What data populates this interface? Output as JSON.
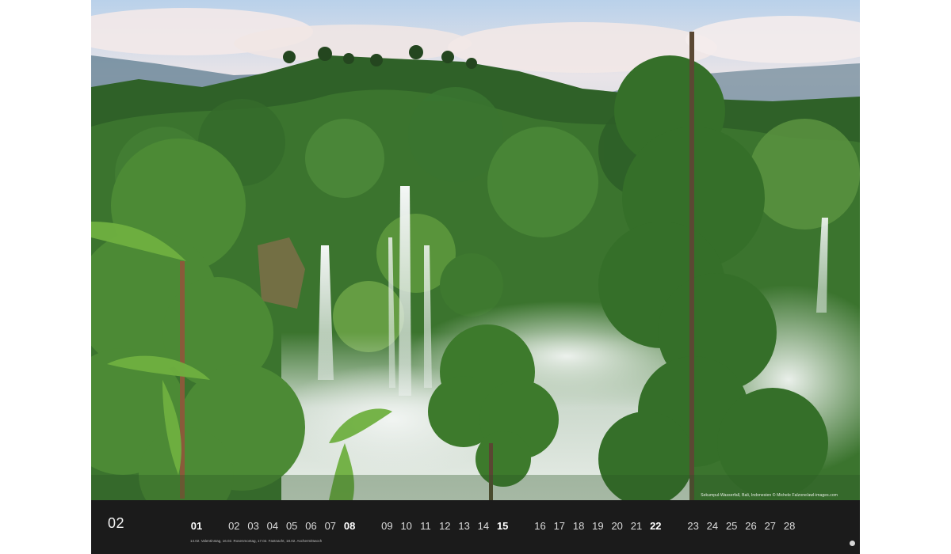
{
  "calendar": {
    "month_number": "02",
    "photo_credit": "Sekumpul-Wasserfall, Bali, Indonesien © Michele Falzone/awl-images.com",
    "holidays": "14.02. Valentinstag, 16.02. Rosenmontag, 17.02. Fastnacht, 18.02. Aschermittwoch",
    "days": [
      {
        "label": "01",
        "bold": true
      },
      {
        "label": "02",
        "bold": false
      },
      {
        "label": "03",
        "bold": false
      },
      {
        "label": "04",
        "bold": false
      },
      {
        "label": "05",
        "bold": false
      },
      {
        "label": "06",
        "bold": false
      },
      {
        "label": "07",
        "bold": false
      },
      {
        "label": "08",
        "bold": true
      },
      {
        "label": "09",
        "bold": false
      },
      {
        "label": "10",
        "bold": false
      },
      {
        "label": "11",
        "bold": false
      },
      {
        "label": "12",
        "bold": false
      },
      {
        "label": "13",
        "bold": false
      },
      {
        "label": "14",
        "bold": false
      },
      {
        "label": "15",
        "bold": true
      },
      {
        "label": "16",
        "bold": false
      },
      {
        "label": "17",
        "bold": false
      },
      {
        "label": "18",
        "bold": false
      },
      {
        "label": "19",
        "bold": false
      },
      {
        "label": "20",
        "bold": false
      },
      {
        "label": "21",
        "bold": false
      },
      {
        "label": "22",
        "bold": true
      },
      {
        "label": "23",
        "bold": false
      },
      {
        "label": "24",
        "bold": false
      },
      {
        "label": "25",
        "bold": false
      },
      {
        "label": "26",
        "bold": false
      },
      {
        "label": "27",
        "bold": false
      },
      {
        "label": "28",
        "bold": false
      }
    ]
  },
  "colors": {
    "strip_background": "#1b1b1b",
    "foliage": "#3f7a2e",
    "sky": "#cfe0ee",
    "mist": "#e6ece8"
  }
}
